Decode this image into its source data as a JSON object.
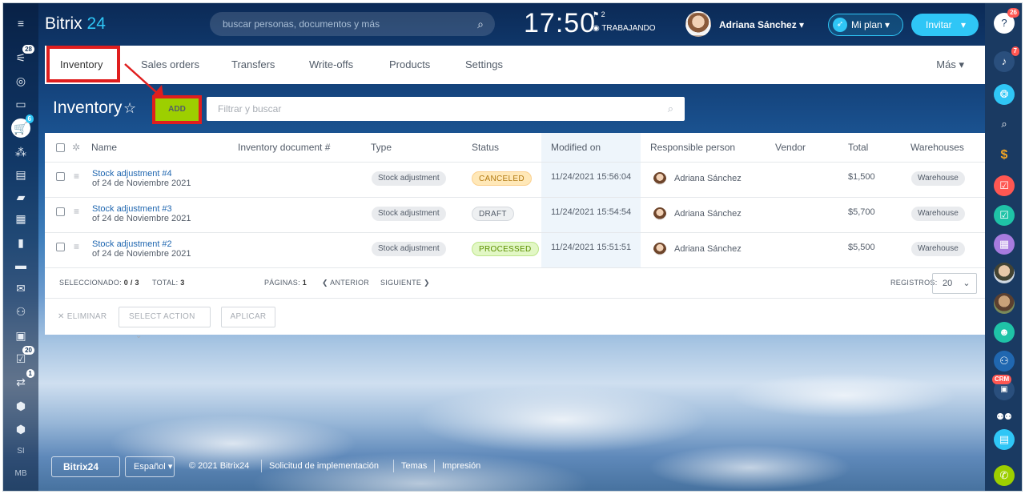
{
  "header": {
    "logo_text": "Bitrix",
    "logo_num": "24",
    "search_placeholder": "buscar personas, documentos y más",
    "clock": "17:50",
    "flag_count": "2",
    "work_status": "TRABAJANDO",
    "user_name": "Adriana Sánchez",
    "plan_label": "Mi plan",
    "invite_label": "Invitar"
  },
  "leftbar": {
    "badges": {
      "feed": "28",
      "shop": "6",
      "tasks": "20",
      "inbox": "1"
    },
    "labels": {
      "si": "SI",
      "mb": "MB"
    }
  },
  "tabs": {
    "items": [
      "Inventory",
      "Sales orders",
      "Transfers",
      "Write-offs",
      "Products",
      "Settings"
    ],
    "more": "Más"
  },
  "toolbar": {
    "title": "Inventory",
    "add_label": "ADD",
    "filter_placeholder": "Filtrar y buscar"
  },
  "grid": {
    "columns": [
      "Name",
      "Inventory document #",
      "Type",
      "Status",
      "Modified on",
      "Responsible person",
      "Vendor",
      "Total",
      "Warehouses"
    ],
    "rows": [
      {
        "name": "Stock adjustment #4",
        "sub": "of 24 de Noviembre 2021",
        "type": "Stock adjustment",
        "status": "CANCELED",
        "modified": "11/24/2021 15:56:04",
        "person": "Adriana Sánchez",
        "total": "$1,500",
        "warehouse": "Warehouse"
      },
      {
        "name": "Stock adjustment #3",
        "sub": "of 24 de Noviembre 2021",
        "type": "Stock adjustment",
        "status": "DRAFT",
        "modified": "11/24/2021 15:54:54",
        "person": "Adriana Sánchez",
        "total": "$5,700",
        "warehouse": "Warehouse"
      },
      {
        "name": "Stock adjustment #2",
        "sub": "of 24 de Noviembre 2021",
        "type": "Stock adjustment",
        "status": "PROCESSED",
        "modified": "11/24/2021 15:51:51",
        "person": "Adriana Sánchez",
        "total": "$5,500",
        "warehouse": "Warehouse"
      }
    ],
    "footer": {
      "selected_label": "SELECCIONADO:",
      "selected_value": "0 / 3",
      "total_label": "TOTAL:",
      "total_value": "3",
      "pages_label": "PÁGINAS:",
      "pages_value": "1",
      "prev": "ANTERIOR",
      "next": "SIGUIENTE",
      "records_label": "REGISTROS:",
      "records_value": "20"
    },
    "actions": {
      "delete": "ELIMINAR",
      "select_action": "SELECT ACTION",
      "apply": "APLICAR"
    }
  },
  "footer": {
    "brand": "Bitrix24",
    "language": "Español",
    "copyright": "© 2021 Bitrix24",
    "link1": "Solicitud de implementación",
    "link2": "Temas",
    "link3": "Impresión"
  },
  "rightbar": {
    "badges": {
      "help": "26",
      "notifications": "7"
    },
    "crm_label": "CRM"
  },
  "colors": {
    "accent": "#2fc6f6",
    "add_button": "#9dcf00",
    "highlight": "#e01e1e",
    "link": "#2067b0"
  }
}
